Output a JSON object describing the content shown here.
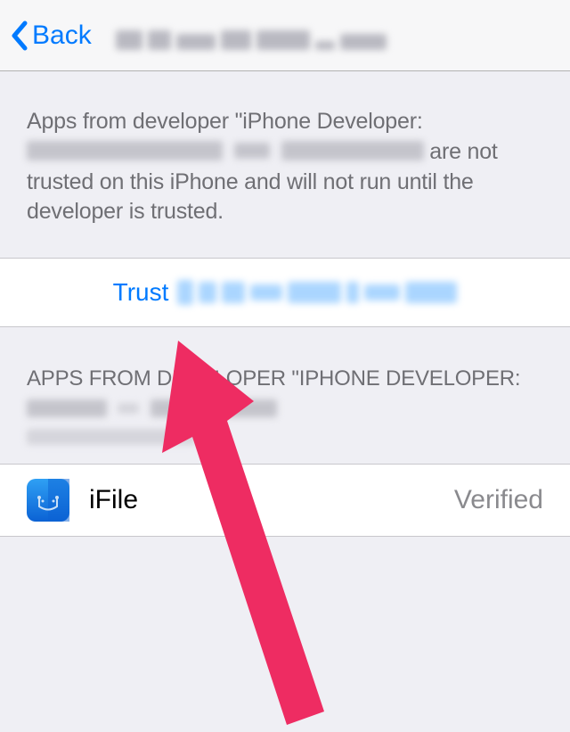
{
  "navbar": {
    "back_label": "Back"
  },
  "explain": {
    "prefix": "Apps from developer \"iPhone Developer:",
    "suffix_line1": "are not",
    "suffix_line2": "trusted on this iPhone and will not run until the developer is trusted."
  },
  "trust": {
    "label": "Trust"
  },
  "section": {
    "header_prefix": "APPS FROM DEVELOPER \"IPHONE DEVELOPER:"
  },
  "app": {
    "name": "iFile",
    "status": "Verified"
  },
  "colors": {
    "ios_blue": "#007aff",
    "arrow": "#ee2c62"
  }
}
